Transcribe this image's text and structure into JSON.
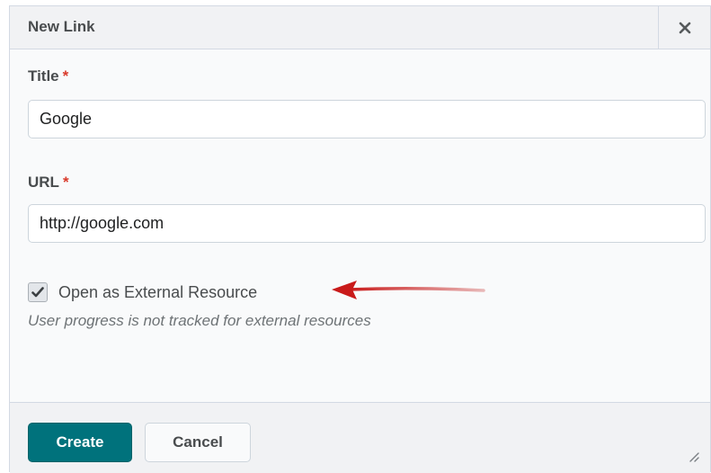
{
  "dialog": {
    "title": "New Link",
    "close_icon": "close-icon"
  },
  "form": {
    "title_label": "Title",
    "title_required": "*",
    "title_value": "Google",
    "url_label": "URL",
    "url_required": "*",
    "url_value": "http://google.com",
    "external_checked": true,
    "external_label": "Open as External Resource",
    "external_help": "User progress is not tracked for external resources"
  },
  "footer": {
    "create_label": "Create",
    "cancel_label": "Cancel"
  },
  "colors": {
    "primary_button": "#00727c",
    "required_asterisk": "#d93a2b",
    "annotation_arrow": "#c91a1a"
  }
}
